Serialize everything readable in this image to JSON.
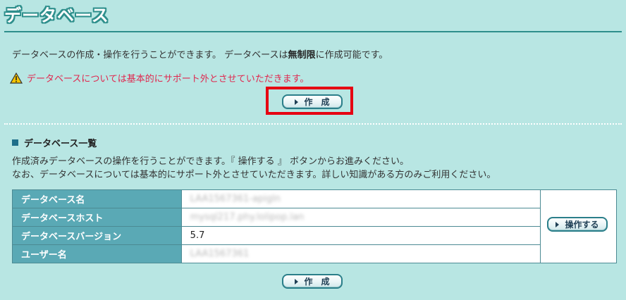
{
  "page": {
    "title": "データベース"
  },
  "intro": {
    "text_before": "データベースの作成・操作を行うことができます。 データベースは",
    "bold": "無制限",
    "text_after": "に作成可能です。"
  },
  "warning": {
    "text": "データベースについては基本的にサポート外とさせていただきます。",
    "icon": "warning-icon"
  },
  "buttons": {
    "create_label": "作成",
    "operate_label": "操作する"
  },
  "section": {
    "heading": "データベース一覧",
    "desc1": "作成済みデータベースの操作を行うことができます。『 操作する 』 ボタンからお進みください。",
    "desc2": "なお、データベースについては基本的にサポート外とさせていただきます。詳しい知識がある方のみご利用ください。"
  },
  "table": {
    "rows": [
      {
        "label": "データベース名",
        "value": "LAA1567361-apigln"
      },
      {
        "label": "データベースホスト",
        "value": "mysql217.phy.lolipop.lan"
      },
      {
        "label": "データベースバージョン",
        "value": "5.7"
      },
      {
        "label": "ユーザー名",
        "value": "LAA1567361"
      }
    ]
  },
  "colors": {
    "background": "#b8e6e3",
    "accent": "#2e8f8c",
    "header_cell": "#5aa9b5",
    "warning": "#e0284f",
    "highlight": "#e60012"
  }
}
